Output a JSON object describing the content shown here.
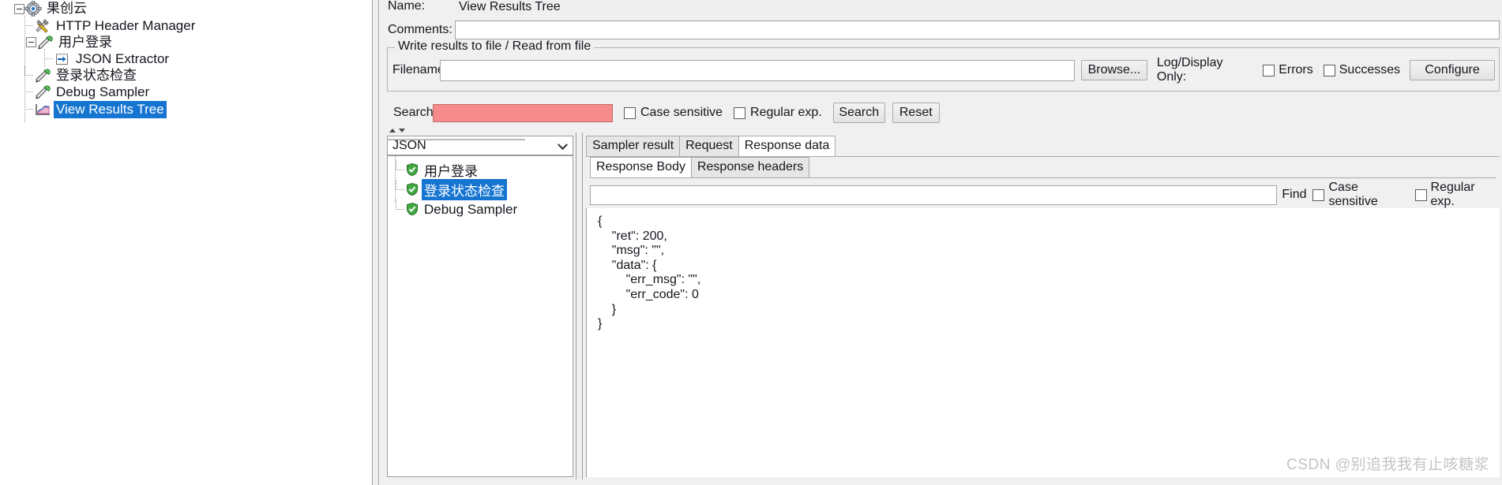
{
  "window": {
    "watermark": "CSDN @别追我我有止咳糖浆"
  },
  "tree": {
    "nodes": [
      {
        "label": "果创云",
        "icon": "test-plan-gear-icon",
        "depth": 0,
        "expanded": true
      },
      {
        "label": "HTTP Header Manager",
        "icon": "header-manager-tools-icon",
        "depth": 1
      },
      {
        "label": "用户登录",
        "icon": "sampler-pipette-icon",
        "depth": 1,
        "expanded": true
      },
      {
        "label": "JSON Extractor",
        "icon": "json-extractor-arrow-icon",
        "depth": 2
      },
      {
        "label": "登录状态检查",
        "icon": "sampler-pipette-icon",
        "depth": 1
      },
      {
        "label": "Debug Sampler",
        "icon": "sampler-pipette-icon",
        "depth": 1
      },
      {
        "label": "View Results Tree",
        "icon": "view-results-tree-chart-icon",
        "depth": 1,
        "selected": true
      }
    ]
  },
  "editor": {
    "name_label": "Name:",
    "name_value": "View Results Tree",
    "comments_label": "Comments:",
    "comments_value": "",
    "file_group_title": "Write results to file / Read from file",
    "filename_label": "Filename",
    "filename_value": "",
    "browse_label": "Browse...",
    "log_display_label": "Log/Display Only:",
    "errors_label": "Errors",
    "errors_checked": false,
    "successes_label": "Successes",
    "successes_checked": false,
    "configure_label": "Configure"
  },
  "search_bar": {
    "search_label": "Search:",
    "search_value": "",
    "case_sensitive_label": "Case sensitive",
    "case_sensitive_checked": false,
    "regular_exp_label": "Regular exp.",
    "regular_exp_checked": false,
    "search_button": "Search",
    "reset_button": "Reset"
  },
  "results": {
    "renderer_selected": "JSON",
    "renderer_options": [
      "JSON"
    ],
    "items": [
      {
        "label": "用户登录",
        "status": "success",
        "selected": false
      },
      {
        "label": "登录状态检查",
        "status": "success",
        "selected": true
      },
      {
        "label": "Debug Sampler",
        "status": "success",
        "selected": false
      }
    ]
  },
  "detail": {
    "tabs": [
      {
        "label": "Sampler result",
        "active": false
      },
      {
        "label": "Request",
        "active": false
      },
      {
        "label": "Response data",
        "active": true
      }
    ],
    "subtabs": [
      {
        "label": "Response Body",
        "active": true
      },
      {
        "label": "Response headers",
        "active": false
      }
    ],
    "find_value": "",
    "find_label": "Find",
    "find_case_sensitive_label": "Case sensitive",
    "find_case_sensitive_checked": false,
    "find_regular_exp_label": "Regular exp.",
    "find_regular_exp_checked": false,
    "response_body": "{\n    \"ret\": 200,\n    \"msg\": \"\",\n    \"data\": {\n        \"err_msg\": \"\",\n        \"err_code\": 0\n    }\n}"
  }
}
